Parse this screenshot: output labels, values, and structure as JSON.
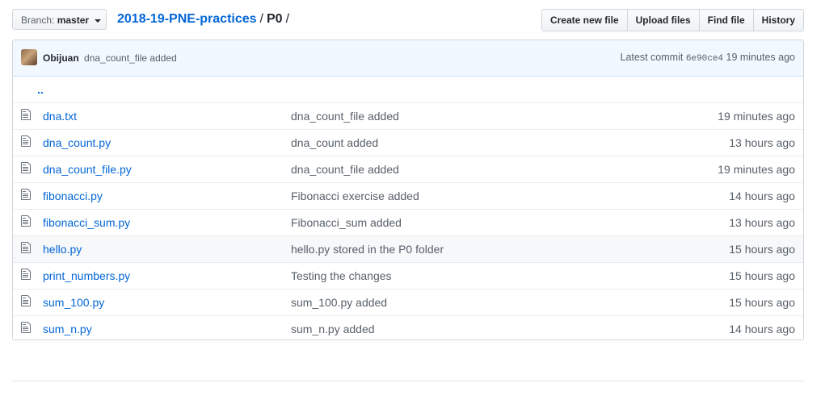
{
  "branch": {
    "prefix": "Branch:",
    "name": "master"
  },
  "breadcrumb": {
    "repo": "2018-19-PNE-practices",
    "separator": "/",
    "current": "P0",
    "trailing": "/"
  },
  "actions": {
    "create": "Create new file",
    "upload": "Upload files",
    "find": "Find file",
    "history": "History"
  },
  "commit": {
    "author": "Obijuan",
    "message": "dna_count_file added",
    "latest_label": "Latest commit",
    "sha": "6e90ce4",
    "age": "19 minutes ago"
  },
  "parent_link": "..",
  "files": [
    {
      "name": "dna.txt",
      "message": "dna_count_file added",
      "age": "19 minutes ago",
      "icon": "file-icon"
    },
    {
      "name": "dna_count.py",
      "message": "dna_count added",
      "age": "13 hours ago",
      "icon": "file-icon"
    },
    {
      "name": "dna_count_file.py",
      "message": "dna_count_file added",
      "age": "19 minutes ago",
      "icon": "file-icon"
    },
    {
      "name": "fibonacci.py",
      "message": "Fibonacci exercise added",
      "age": "14 hours ago",
      "icon": "file-icon"
    },
    {
      "name": "fibonacci_sum.py",
      "message": "Fibonacci_sum added",
      "age": "13 hours ago",
      "icon": "file-icon"
    },
    {
      "name": "hello.py",
      "message": "hello.py stored in the P0 folder",
      "age": "15 hours ago",
      "icon": "file-icon"
    },
    {
      "name": "print_numbers.py",
      "message": "Testing the changes",
      "age": "15 hours ago",
      "icon": "file-icon"
    },
    {
      "name": "sum_100.py",
      "message": "sum_100.py added",
      "age": "15 hours ago",
      "icon": "file-icon"
    },
    {
      "name": "sum_n.py",
      "message": "sum_n.py added",
      "age": "14 hours ago",
      "icon": "file-icon"
    }
  ],
  "colors": {
    "link": "#0366d6",
    "muted": "#586069",
    "commit_bar_bg": "#f1f8ff",
    "hover_row_bg": "#f6f8fa"
  }
}
